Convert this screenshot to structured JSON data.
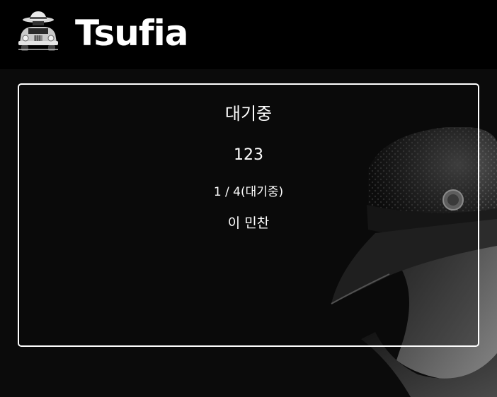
{
  "header": {
    "brand": "Tsufia",
    "logo_icon": "gangster-car-logo-icon"
  },
  "room": {
    "status": "대기중",
    "name": "123",
    "players": "1 / 4(대기중)",
    "host": "이 민찬"
  },
  "colors": {
    "header_bg": "#000000",
    "page_bg": "#0b0b0b",
    "text": "#ffffff",
    "card_border": "#ffffff"
  }
}
